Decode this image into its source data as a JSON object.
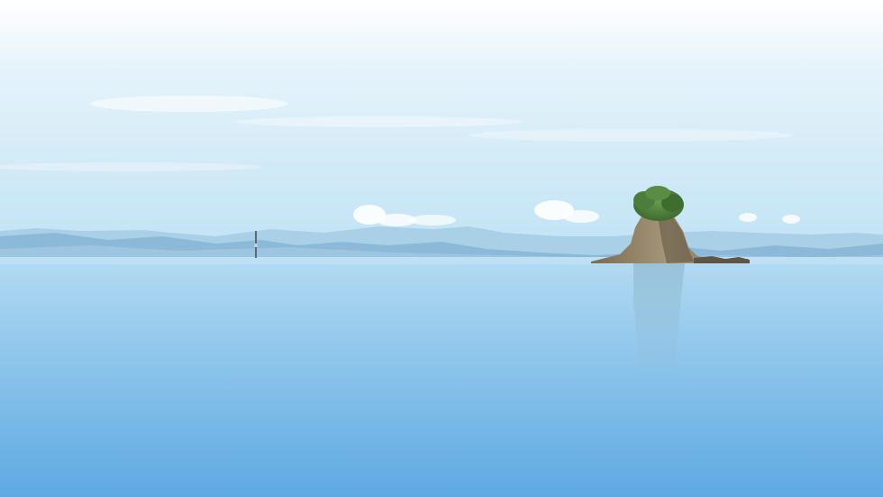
{
  "scene": {
    "subject": "",
    "colors": {
      "sky_top": "#ffffff",
      "sky_mid": "#d8eef8",
      "sky_horizon": "#bfe3f5",
      "mountains_far": "#a9cfe6",
      "mountains_near": "#8fbad8",
      "water_top": "#a7d3ef",
      "water_bottom": "#5ea9e2",
      "rock": "#9a8a6a",
      "rock_shadow": "#6d6048",
      "tree": "#4f7f3c",
      "cloud": "#ffffff"
    }
  }
}
